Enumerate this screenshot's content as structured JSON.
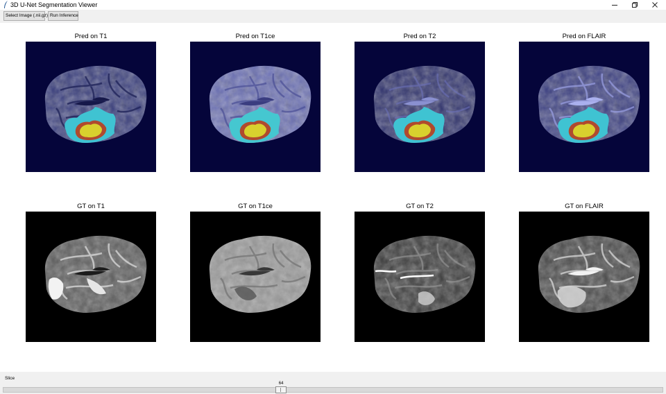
{
  "window": {
    "title": "3D U-Net Segmentation Viewer",
    "minimize_icon": "minimize-icon",
    "maximize_icon": "restore-icon",
    "close_icon": "close-icon"
  },
  "toolbar": {
    "select_image_label": "Select Image (.nii.gz)",
    "run_inference_label": "Run Inference"
  },
  "panels": {
    "pred": [
      {
        "title": "Pred on T1"
      },
      {
        "title": "Pred on T1ce"
      },
      {
        "title": "Pred on T2"
      },
      {
        "title": "Pred on FLAIR"
      }
    ],
    "gt": [
      {
        "title": "GT on T1"
      },
      {
        "title": "GT on T1ce"
      },
      {
        "title": "GT on T2"
      },
      {
        "title": "GT on FLAIR"
      }
    ]
  },
  "slider": {
    "label": "Slice",
    "value": "64",
    "position_fraction": 0.42
  },
  "colors": {
    "pred_background": "#05053a",
    "gt_background": "#000000",
    "edema": "#3fc3d2",
    "tumor_core": "#b04a2e",
    "enhancing": "#d8d12e"
  }
}
